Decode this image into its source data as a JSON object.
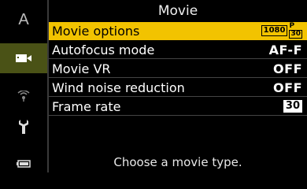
{
  "title": "Movie",
  "menu": [
    {
      "label": "Movie options",
      "value_type": "movie_badge",
      "badge_res": "1080",
      "badge_p": "P",
      "badge_fps": "30"
    },
    {
      "label": "Autofocus mode",
      "value": "AF-F"
    },
    {
      "label": "Movie VR",
      "value": "OFF"
    },
    {
      "label": "Wind noise reduction",
      "value": "OFF"
    },
    {
      "label": "Frame rate",
      "value": "30"
    }
  ],
  "help_text": "Choose a movie type.",
  "rail": {
    "a_label": "A",
    "icons": [
      "a-letter",
      "movie-camera-icon",
      "wireless-icon",
      "wrench-icon",
      "battery-icon"
    ]
  },
  "colors": {
    "selected_bg": "#f2c300",
    "rail_active": "#4a5216"
  }
}
